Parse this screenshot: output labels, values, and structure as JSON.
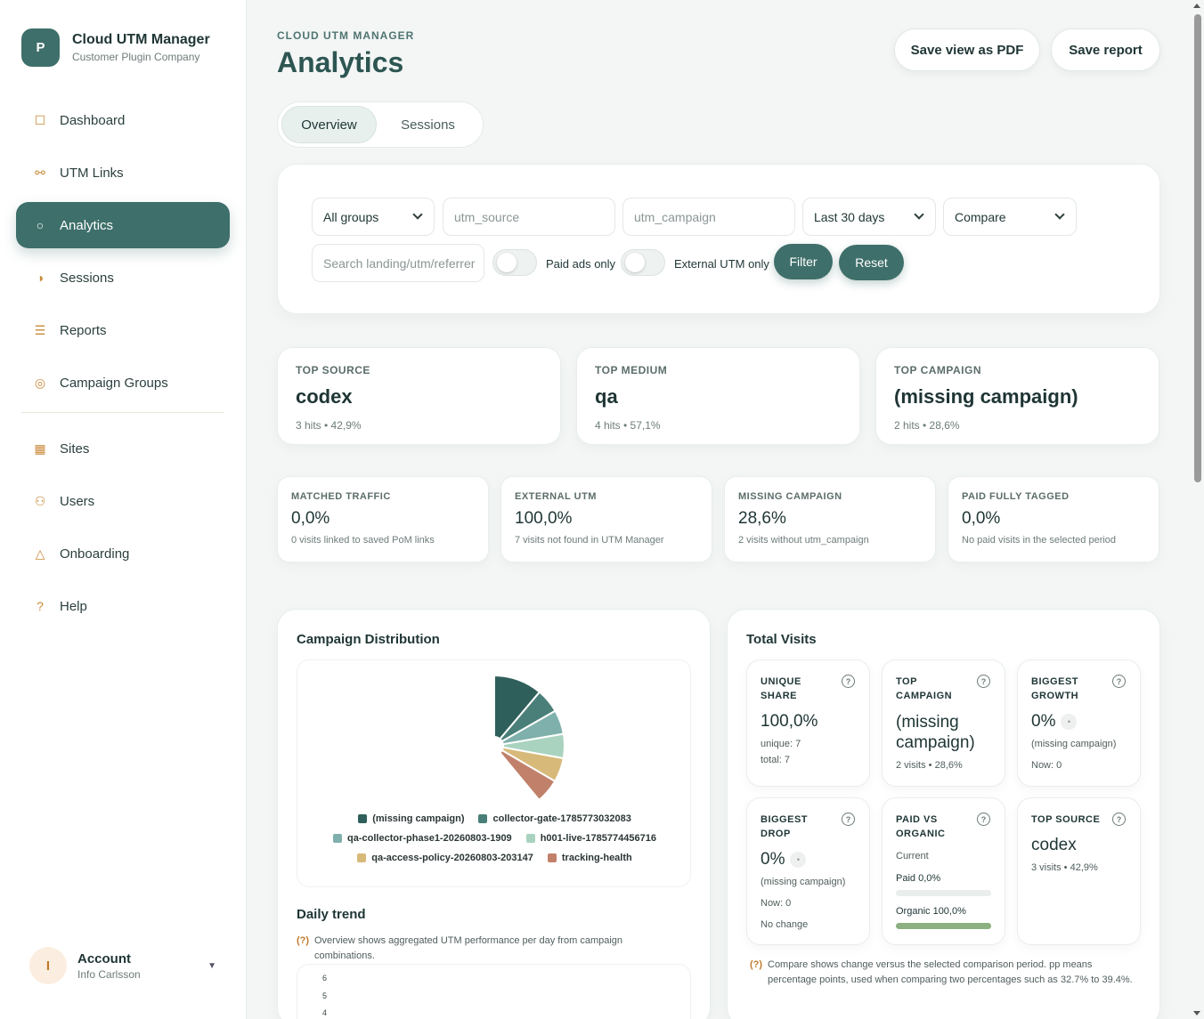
{
  "app": {
    "logo_letter": "P",
    "title": "Cloud UTM Manager",
    "subtitle": "Customer Plugin Company"
  },
  "sidebar": {
    "items": [
      {
        "label": "Dashboard",
        "icon": "square-icon",
        "glyph": "☐"
      },
      {
        "label": "UTM Links",
        "icon": "link-icon",
        "glyph": "⚯"
      },
      {
        "label": "Analytics",
        "icon": "circle-icon",
        "glyph": "○",
        "active": true
      },
      {
        "label": "Sessions",
        "icon": "half-circle-icon",
        "glyph": "◑"
      },
      {
        "label": "Reports",
        "icon": "list-icon",
        "glyph": "☰"
      },
      {
        "label": "Campaign Groups",
        "icon": "target-icon",
        "glyph": "◎"
      },
      {
        "label": "Sites",
        "icon": "grid-icon",
        "glyph": "▦"
      },
      {
        "label": "Users",
        "icon": "users-icon",
        "glyph": "⚇"
      },
      {
        "label": "Onboarding",
        "icon": "triangle-icon",
        "glyph": "△"
      },
      {
        "label": "Help",
        "icon": "question-icon",
        "glyph": "?"
      }
    ]
  },
  "account": {
    "initial": "I",
    "name": "Account",
    "email": "Info Carlsson"
  },
  "header": {
    "eyebrow": "CLOUD UTM MANAGER",
    "title": "Analytics",
    "save_pdf": "Save view as PDF",
    "save_report": "Save report"
  },
  "tabs": {
    "overview": "Overview",
    "sessions": "Sessions"
  },
  "filters": {
    "groups": "All groups",
    "utm_source_placeholder": "utm_source",
    "utm_campaign_placeholder": "utm_campaign",
    "period": "Last 30 days",
    "compare": "Compare",
    "search_placeholder": "Search landing/utm/referrer",
    "paid_ads_label": "Paid ads only",
    "external_utm_label": "External UTM only",
    "filter_btn": "Filter",
    "reset_btn": "Reset"
  },
  "top_cards": [
    {
      "label": "TOP SOURCE",
      "value": "codex",
      "sub": "3 hits • 42,9%"
    },
    {
      "label": "TOP MEDIUM",
      "value": "qa",
      "sub": "4 hits • 57,1%"
    },
    {
      "label": "TOP CAMPAIGN",
      "value": "(missing campaign)",
      "sub": "2 hits • 28,6%"
    }
  ],
  "kpis": [
    {
      "label": "MATCHED TRAFFIC",
      "value": "0,0%",
      "sub": "0 visits linked to saved PoM links"
    },
    {
      "label": "EXTERNAL UTM",
      "value": "100,0%",
      "sub": "7 visits not found in UTM Manager"
    },
    {
      "label": "MISSING CAMPAIGN",
      "value": "28,6%",
      "sub": "2 visits without utm_campaign"
    },
    {
      "label": "PAID FULLY TAGGED",
      "value": "0,0%",
      "sub": "No paid visits in the selected period"
    }
  ],
  "campaign_panel": {
    "title": "Campaign Distribution",
    "daily_title": "Daily trend",
    "note_marker": "(?)",
    "daily_note": "Overview shows aggregated UTM performance per day from campaign combinations.",
    "y_ticks": [
      "6",
      "5",
      "4"
    ]
  },
  "chart_data": {
    "type": "pie",
    "title": "Campaign Distribution",
    "categories": [
      "(missing campaign)",
      "collector-gate-1785773032083",
      "qa-collector-phase1-20260803-1909",
      "h001-live-1785774456716",
      "qa-access-policy-20260803-203147",
      "tracking-health"
    ],
    "values": [
      2,
      1,
      1,
      1,
      1,
      1
    ],
    "colors": [
      "#2f5f5b",
      "#4a7f79",
      "#7fb0ab",
      "#a9d3bf",
      "#d7b97a",
      "#c0806a"
    ],
    "legend": "bottom"
  },
  "visits_panel": {
    "title": "Total Visits",
    "unique_share": {
      "label": "UNIQUE SHARE",
      "value": "100,0%",
      "unique": "unique: 7",
      "total": "total: 7"
    },
    "top_campaign": {
      "label": "TOP CAMPAIGN",
      "value": "(missing campaign)",
      "sub": "2 visits • 28,6%"
    },
    "biggest_growth": {
      "label": "BIGGEST GROWTH",
      "value": "0%",
      "badge": "•",
      "campaign": "(missing campaign)",
      "now": "Now: 0"
    },
    "biggest_drop": {
      "label": "BIGGEST DROP",
      "value": "0%",
      "badge": "•",
      "campaign": "(missing campaign)",
      "now": "Now: 0",
      "change": "No change"
    },
    "paid_vs_organic": {
      "label": "PAID VS ORGANIC",
      "current": "Current",
      "paid": "Paid 0,0%",
      "organic": "Organic 100,0%",
      "paid_share": 0.0,
      "organic_share": 1.0
    },
    "top_source": {
      "label": "TOP SOURCE",
      "value": "codex",
      "sub": "3 visits • 42,9%"
    },
    "help_glyph": "?",
    "compare_note": "Compare shows change versus the selected comparison period. pp means percentage points, used when comparing two percentages such as 32.7% to 39.4%."
  }
}
